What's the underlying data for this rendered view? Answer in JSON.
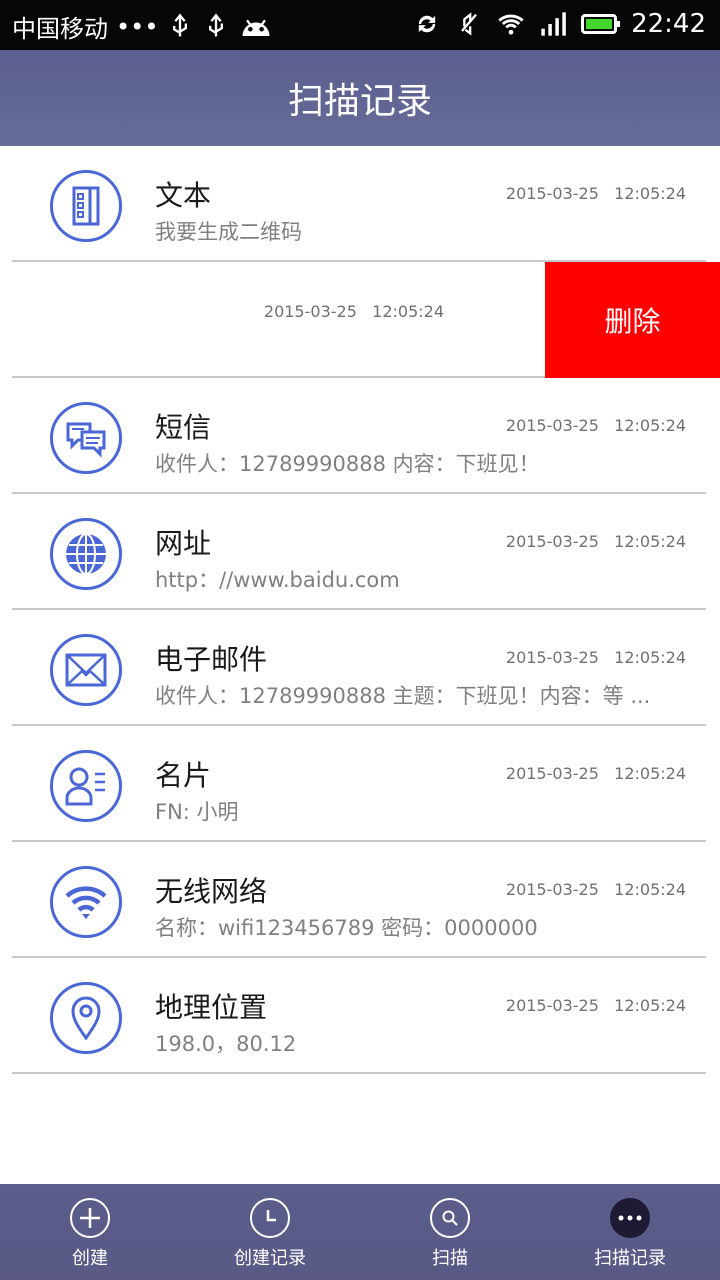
{
  "status_bar": {
    "carrier": "中国移动",
    "dots": "•••",
    "time": "22:42",
    "icons": [
      "usb-icon",
      "usb-icon",
      "android-icon",
      "sync-icon",
      "mute-icon",
      "wifi-icon",
      "signal-icon",
      "battery-icon"
    ]
  },
  "header": {
    "title": "扫描记录"
  },
  "records": [
    {
      "title": "文本",
      "subtitle": "我要生成二维码",
      "time": "2015-03-25   12:05:24",
      "icon": "text-doc-icon"
    },
    {
      "time": "2015-03-25   12:05:24",
      "delete_label": "删除"
    },
    {
      "title": "短信",
      "subtitle": "收件人：12789990888   内容：下班见！",
      "time": "2015-03-25   12:05:24",
      "icon": "sms-icon"
    },
    {
      "title": "网址",
      "subtitle": "http：//www.baidu.com",
      "time": "2015-03-25   12:05:24",
      "icon": "globe-icon"
    },
    {
      "title": "电子邮件",
      "subtitle": "收件人：12789990888   主题：下班见！内容：等 ...",
      "time": "2015-03-25   12:05:24",
      "icon": "mail-icon"
    },
    {
      "title": "名片",
      "subtitle": "FN: 小明",
      "time": "2015-03-25   12:05:24",
      "icon": "contact-card-icon"
    },
    {
      "title": "无线网络",
      "subtitle": "名称：wifi123456789   密码：0000000",
      "time": "2015-03-25   12:05:24",
      "icon": "wifi-icon"
    },
    {
      "title": "地理位置",
      "subtitle": "198.0，80.12",
      "time": "2015-03-25   12:05:24",
      "icon": "location-pin-icon"
    }
  ],
  "bottom_nav": [
    {
      "label": "创建",
      "icon": "plus-icon"
    },
    {
      "label": "创建记录",
      "icon": "clock-icon"
    },
    {
      "label": "扫描",
      "icon": "search-icon"
    },
    {
      "label": "扫描记录",
      "icon": "more-icon",
      "active": true
    }
  ],
  "colors": {
    "accent": "#4b67d6",
    "header": "#5f638f",
    "delete": "#ff0000"
  }
}
